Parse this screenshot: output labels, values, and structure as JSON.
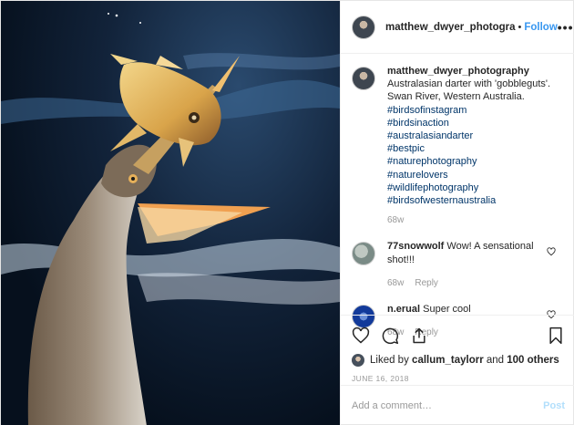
{
  "header": {
    "username": "matthew_dwyer_photogra",
    "separator": "•",
    "follow_label": "Follow",
    "more_label": "•••"
  },
  "caption": {
    "username": "matthew_dwyer_photography",
    "text": "Australasian darter with 'gobbleguts'. Swan River, Western Australia.",
    "hashtags": [
      "#birdsofinstagram",
      "#birdsinaction",
      "#australasiandarter",
      "#bestpic",
      "#naturephotography",
      "#naturelovers",
      "#wildlifephotography",
      "#birdsofwesternaustralia"
    ],
    "time": "68w"
  },
  "comments": [
    {
      "username": "77snowwolf",
      "text": "Wow! A sensational shot!!!",
      "time": "68w",
      "reply_label": "Reply"
    },
    {
      "username": "n.erual",
      "text": "Super cool",
      "time": "68w",
      "reply_label": "Reply"
    }
  ],
  "likes": {
    "prefix": "Liked by",
    "user": "callum_taylorr",
    "joiner": "and",
    "others": "100 others"
  },
  "date": "JUNE 16, 2018",
  "add_comment": {
    "placeholder": "Add a comment…",
    "post_label": "Post"
  },
  "colors": {
    "link": "#3897f0",
    "hashtag": "#003569",
    "muted": "#999999",
    "post_disabled": "#b2dffc"
  }
}
